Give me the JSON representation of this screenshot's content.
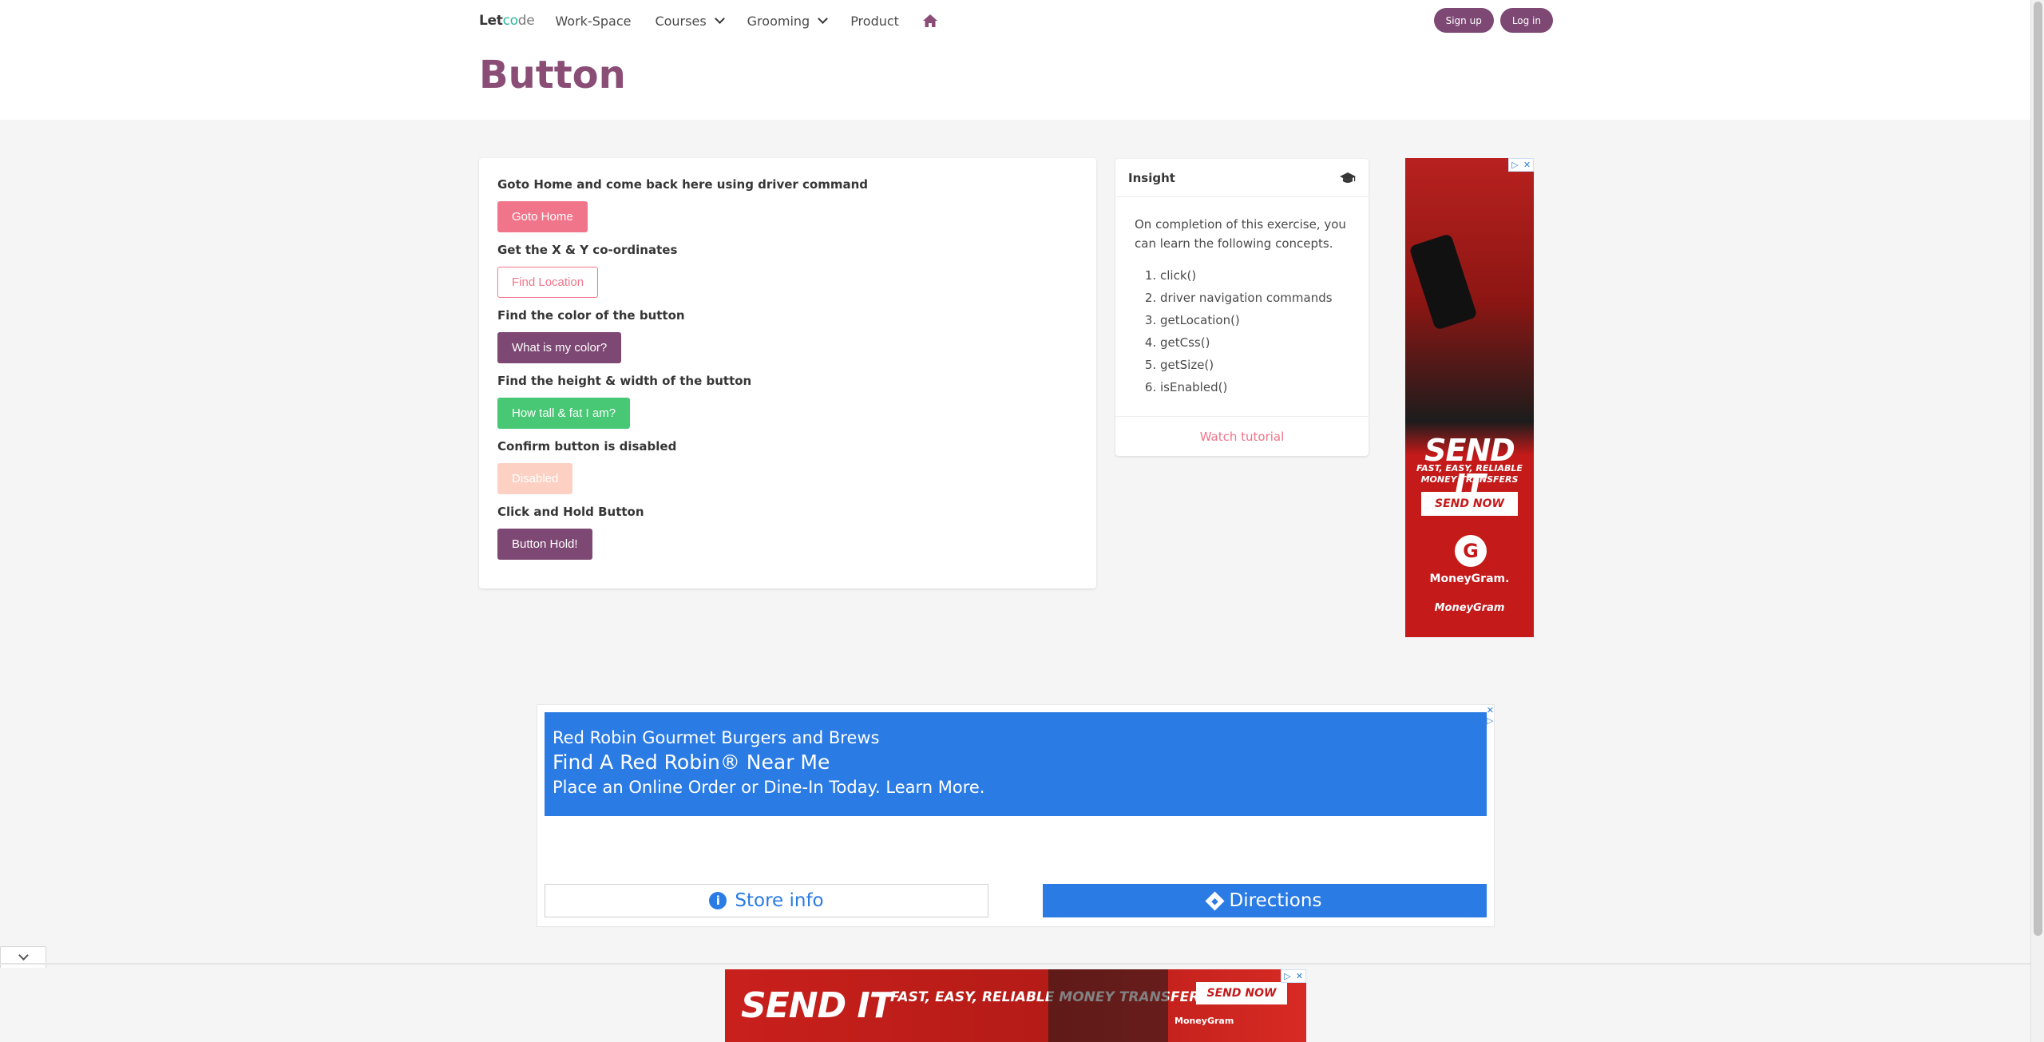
{
  "nav": {
    "brand_prefix": "Let",
    "brand_o": "co",
    "brand_suffix": "de",
    "items": [
      {
        "label": "Work-Space"
      },
      {
        "label": "Courses"
      },
      {
        "label": "Grooming"
      },
      {
        "label": "Product"
      }
    ],
    "signup": "Sign up",
    "login": "Log in",
    "accent": "#7d4873"
  },
  "page": {
    "title": "Button"
  },
  "exercises": [
    {
      "question": "Goto Home and come back here using driver command",
      "button": "Goto Home"
    },
    {
      "question": "Get the X & Y co-ordinates",
      "button": "Find Location"
    },
    {
      "question": "Find the color of the button",
      "button": "What is my color?"
    },
    {
      "question": "Find the height & width of the button",
      "button": "How tall & fat I am?"
    },
    {
      "question": "Confirm button is disabled",
      "button": "Disabled"
    },
    {
      "question": "Click and Hold Button",
      "button": "Button Hold!"
    }
  ],
  "insight": {
    "title": "Insight",
    "intro": "On completion of this exercise, you can learn the following concepts.",
    "concepts": [
      "click()",
      "driver navigation commands",
      "getLocation()",
      "getCss()",
      "getSize()",
      "isEnabled()"
    ],
    "footer_link": "Watch tutorial"
  },
  "ads": {
    "vertical": {
      "headline": "SEND IT",
      "tagline": "FAST, EASY, RELIABLE MONEY TRANSFERS",
      "cta": "SEND NOW",
      "logo_letter": "G",
      "brand": "MoneyGram.",
      "team": "MoneyGram"
    },
    "red_robin": {
      "line1": "Red Robin Gourmet Burgers and Brews",
      "line2": "Find A Red Robin® Near Me",
      "line3": "Place an Online Order or Dine-In Today. Learn More.",
      "store_info": "Store info",
      "directions": "Directions"
    },
    "banner": {
      "headline": "SEND IT",
      "tagline": "FAST, EASY, RELIABLE MONEY TRANSFERS",
      "cta": "SEND NOW",
      "brand": "MoneyGram"
    }
  }
}
